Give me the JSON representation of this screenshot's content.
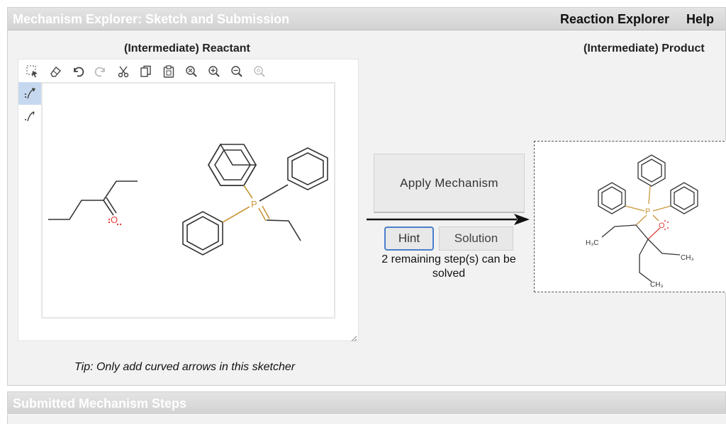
{
  "header": {
    "title": "Mechanism Explorer: Sketch and Submission",
    "links": [
      "Reaction Explorer",
      "Help"
    ]
  },
  "reactant": {
    "label": "(Intermediate) Reactant",
    "tip": "Tip: Only add curved arrows in this sketcher",
    "toolbar_icons": [
      "selection-icon",
      "eraser-icon",
      "undo-icon",
      "redo-icon",
      "cut-icon",
      "copy-icon",
      "paste-icon",
      "zoom-fit-icon",
      "zoom-in-icon",
      "zoom-out-icon",
      "zoom-reset-icon"
    ],
    "side_tools": [
      "curved-arrow-electron-pair-icon",
      "curved-arrow-single-electron-icon"
    ],
    "atoms": {
      "oxygen": "O",
      "phosphorus": "P"
    }
  },
  "actions": {
    "apply": "Apply Mechanism",
    "hint": "Hint",
    "solution": "Solution",
    "remaining": "2 remaining step(s) can be solved"
  },
  "product": {
    "label": "(Intermediate) Product",
    "atoms": {
      "phosphorus": "P",
      "oxygen": "O",
      "methyl_a": "H₃C",
      "methyl_b": "CH₃",
      "methyl_c": "CH₃"
    }
  },
  "submitted": {
    "title": "Submitted Mechanism Steps"
  },
  "colors": {
    "oxygen": "#e0413c",
    "phosphorus": "#c8973a",
    "hint_border": "#4a7fcc",
    "active_tool": "#c6d8f0"
  }
}
